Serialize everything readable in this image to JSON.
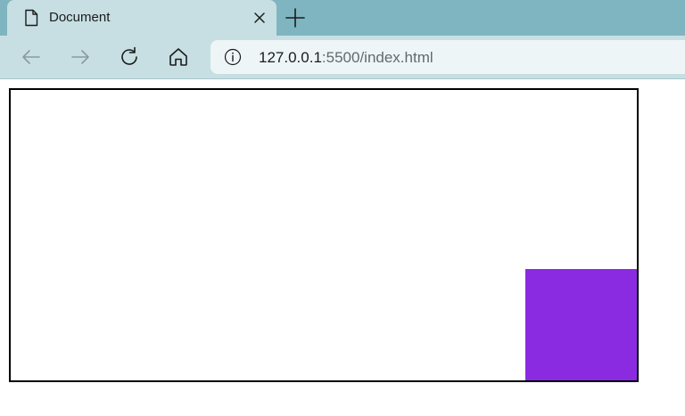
{
  "tab": {
    "title": "Document"
  },
  "address_bar": {
    "host": "127.0.0.1",
    "rest": ":5500/index.html"
  },
  "page": {
    "box_color": "#8a2be2",
    "container_border_color": "#000000"
  }
}
